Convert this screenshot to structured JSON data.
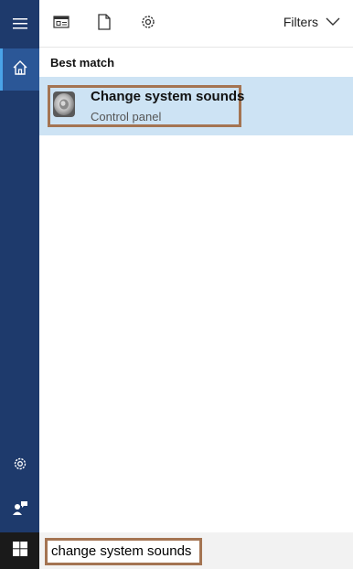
{
  "rail": {
    "items": [
      {
        "icon": "hamburger-menu-icon"
      },
      {
        "icon": "home-icon"
      },
      {
        "icon": "gear-icon"
      },
      {
        "icon": "feedback-person-icon"
      }
    ]
  },
  "topbar": {
    "icons": [
      "apps-icon",
      "document-icon",
      "settings-icon"
    ],
    "filters_label": "Filters"
  },
  "results": {
    "section_label": "Best match",
    "items": [
      {
        "title": "Change system sounds",
        "subtitle": "Control panel",
        "icon": "speaker-icon"
      }
    ]
  },
  "search": {
    "value": "change system sounds"
  },
  "colors": {
    "rail": "#1e3a6c",
    "rail_active": "#2b5797",
    "selected_result": "#cde3f4",
    "highlight_border": "#a47452"
  }
}
